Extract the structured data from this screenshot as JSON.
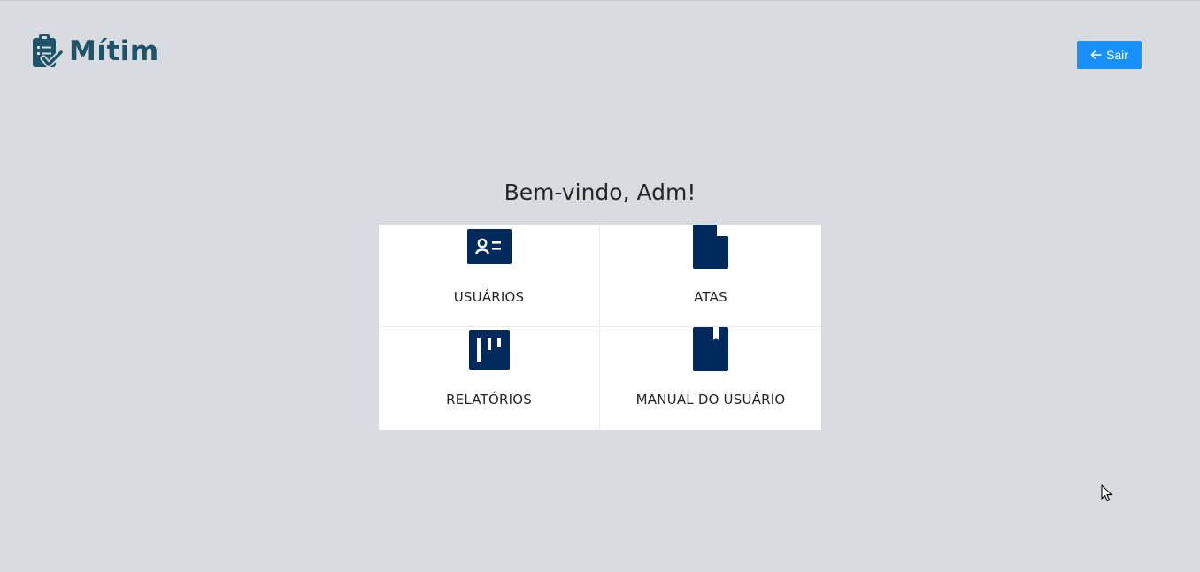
{
  "header": {
    "logo_text": "Mítim",
    "logout_label": "Sair"
  },
  "welcome": {
    "title": "Bem-vindo, Adm!"
  },
  "menu": {
    "items": [
      {
        "label": "USUÁRIOS",
        "icon": "id-card-icon"
      },
      {
        "label": "ATAS",
        "icon": "file-icon"
      },
      {
        "label": "RELATÓRIOS",
        "icon": "project-board-icon"
      },
      {
        "label": "MANUAL DO USUÁRIO",
        "icon": "book-icon"
      }
    ]
  },
  "colors": {
    "background": "#d8dbe0",
    "primary_button": "#1890ff",
    "icon_navy": "#002a5c",
    "logo": "#1f5468"
  }
}
